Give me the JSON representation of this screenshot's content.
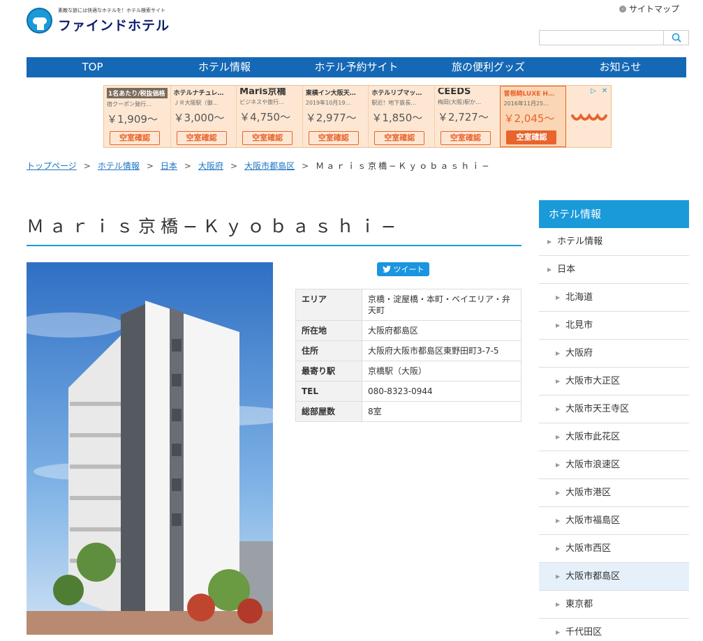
{
  "header": {
    "tagline": "素敵な旅には快適なホテルを！ホテル検索サイト",
    "site_name": "ファインドホテル",
    "sitemap_label": "サイトマップ",
    "search_placeholder": ""
  },
  "nav": [
    "TOP",
    "ホテル情報",
    "ホテル予約サイト",
    "旅の便利グッズ",
    "お知らせ"
  ],
  "ad": {
    "items": [
      {
        "name": "1名あたり/税抜価格",
        "sub": "宿クーポン発行…",
        "price": "￥1,909〜",
        "button": "空室確認",
        "style": "badge"
      },
      {
        "name": "ホテルナチュレ…",
        "sub": "ＪＲ大阪駅（御…",
        "price": "￥3,000〜",
        "button": "空室確認",
        "style": ""
      },
      {
        "name": "Maris京橋",
        "sub": "ビジネスや旅行…",
        "price": "￥4,750〜",
        "button": "空室確認",
        "style": "big"
      },
      {
        "name": "東横イン大阪天…",
        "sub": "2019年10月19…",
        "price": "￥2,977〜",
        "button": "空室確認",
        "style": ""
      },
      {
        "name": "ホテルリブマッ…",
        "sub": "駅近！地下鉄長…",
        "price": "￥1,850〜",
        "button": "空室確認",
        "style": ""
      },
      {
        "name": "CEEDS",
        "sub": "梅田(大阪)駅か…",
        "price": "￥2,727〜",
        "button": "空室確認",
        "style": "big"
      },
      {
        "name": "曽根崎LUXE H…",
        "sub": "2016年11月25…",
        "price": "￥2,045〜",
        "button": "空室確認",
        "style": "orange",
        "active": true
      }
    ]
  },
  "breadcrumb": {
    "items": [
      "トップページ",
      "ホテル情報",
      "日本",
      "大阪府",
      "大阪市都島区"
    ],
    "current": "Ｍａｒｉｓ京橋−Ｋｙｏｂａｓｈｉ−"
  },
  "title": "Ｍａｒｉｓ京橋−Ｋｙｏｂａｓｈｉ−",
  "tweet_label": "ツイート",
  "info": [
    {
      "label": "エリア",
      "value": "京橋・淀屋橋・本町・ベイエリア・弁天町"
    },
    {
      "label": "所在地",
      "value": "大阪府都島区"
    },
    {
      "label": "住所",
      "value": "大阪府大阪市都島区東野田町3-7-5"
    },
    {
      "label": "最寄り駅",
      "value": "京橋駅（大阪）"
    },
    {
      "label": "TEL",
      "value": "080-8323-0944"
    },
    {
      "label": "総部屋数",
      "value": "8室"
    }
  ],
  "sidebar": {
    "title": "ホテル情報",
    "items": [
      {
        "label": "ホテル情報",
        "level": 1
      },
      {
        "label": "日本",
        "level": 1
      },
      {
        "label": "北海道",
        "level": 2
      },
      {
        "label": "北見市",
        "level": 2
      },
      {
        "label": "大阪府",
        "level": 2
      },
      {
        "label": "大阪市大正区",
        "level": 2
      },
      {
        "label": "大阪市天王寺区",
        "level": 2
      },
      {
        "label": "大阪市此花区",
        "level": 2
      },
      {
        "label": "大阪市浪速区",
        "level": 2
      },
      {
        "label": "大阪市港区",
        "level": 2
      },
      {
        "label": "大阪市福島区",
        "level": 2
      },
      {
        "label": "大阪市西区",
        "level": 2
      },
      {
        "label": "大阪市都島区",
        "level": 2,
        "selected": true
      },
      {
        "label": "東京都",
        "level": 2
      },
      {
        "label": "千代田区",
        "level": 2
      }
    ]
  },
  "colors": {
    "nav": "#1568b5",
    "accent": "#1a9ad9",
    "ad_orange": "#e8632d"
  }
}
